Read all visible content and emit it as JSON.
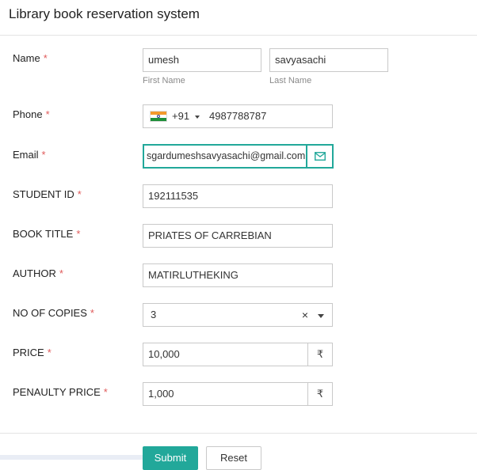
{
  "form": {
    "title": "Library book reservation system",
    "required_mark": "*",
    "name": {
      "label": "Name",
      "first_value": "umesh",
      "first_sublabel": "First Name",
      "last_value": "savyasachi",
      "last_sublabel": "Last Name"
    },
    "phone": {
      "label": "Phone",
      "country_code": "+91",
      "value": "4987788787"
    },
    "email": {
      "label": "Email",
      "value": "sgardumeshsavyasachi@gmail.com|"
    },
    "student_id": {
      "label": "STUDENT ID",
      "value": "192111535"
    },
    "book_title": {
      "label": "BOOK TITLE",
      "value": "PRIATES OF CARREBIAN"
    },
    "author": {
      "label": "AUTHOR",
      "value": "MATIRLUTHEKING"
    },
    "copies": {
      "label": "NO OF COPIES",
      "value": "3",
      "clear": "×"
    },
    "price": {
      "label": "PRICE",
      "value": "10,000",
      "currency": "₹"
    },
    "penalty_price": {
      "label": "PENAULTY PRICE",
      "value": "1,000",
      "currency": "₹"
    },
    "submit_label": "Submit",
    "reset_label": "Reset"
  },
  "colors": {
    "accent": "#22a89a",
    "required": "#e05a5a",
    "border": "#c9c9c9"
  },
  "icons": {
    "email": "envelope-icon",
    "phone_country": "india-flag-icon",
    "dropdown": "caret-down-icon"
  }
}
